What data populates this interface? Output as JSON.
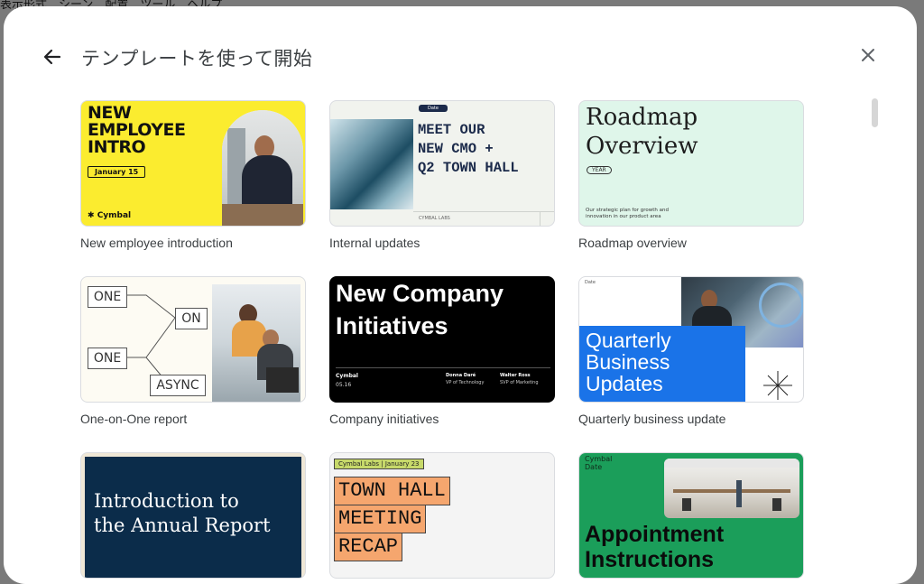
{
  "background_menu": "表示形式　シーン　配置　ツール　ヘルプ",
  "dialog": {
    "title": "テンプレートを使って開始",
    "back_icon": "arrow-left-icon",
    "close_icon": "close-icon"
  },
  "templates": [
    {
      "caption": "New employee introduction",
      "thumb_title": "NEW\nEMPLOYEE\nINTRO",
      "date": "January 15",
      "brand": "Cymbal",
      "accent": "#fbec2f"
    },
    {
      "caption": "Internal updates",
      "thumb_title": "MEET OUR\nNEW CMO +\nQ2 TOWN HALL",
      "tag": "Date",
      "footer": "CYMBAL LABS",
      "accent": "#f1f3ee"
    },
    {
      "caption": "Roadmap overview",
      "thumb_title": "Roadmap\nOverview",
      "badge": "YEAR",
      "desc": "Our strategic plan for growth and innovation in our product area",
      "accent": "#dff6ea"
    },
    {
      "caption": "One-on-One report",
      "boxes": [
        "ONE",
        "ON",
        "ONE",
        "ASYNC"
      ],
      "accent": "#fdfbf3"
    },
    {
      "caption": "Company initiatives",
      "thumb_title": "New Company\nInitiatives",
      "brand": "Cymbal",
      "date": "05.16",
      "person1": "Donna Daré",
      "role1": "VP of Technology",
      "person2": "Walter Ross",
      "role2": "SVP of Marketing",
      "accent": "#000000"
    },
    {
      "caption": "Quarterly business update",
      "thumb_title": "Quarterly\nBusiness\nUpdates",
      "tag": "Date",
      "accent": "#1a73e8"
    },
    {
      "caption": "",
      "thumb_title": "Introduction to\nthe Annual Report",
      "accent": "#0b2c4a"
    },
    {
      "caption": "",
      "tag": "Cymbal Labs  |  January 23",
      "lines": [
        "TOWN HALL",
        "MEETING",
        "RECAP"
      ],
      "accent": "#f5a66e"
    },
    {
      "caption": "",
      "brand": "Cymbal",
      "tag": "Date",
      "thumb_title": "Appointment\nInstructions",
      "accent": "#1b9e5a"
    }
  ]
}
